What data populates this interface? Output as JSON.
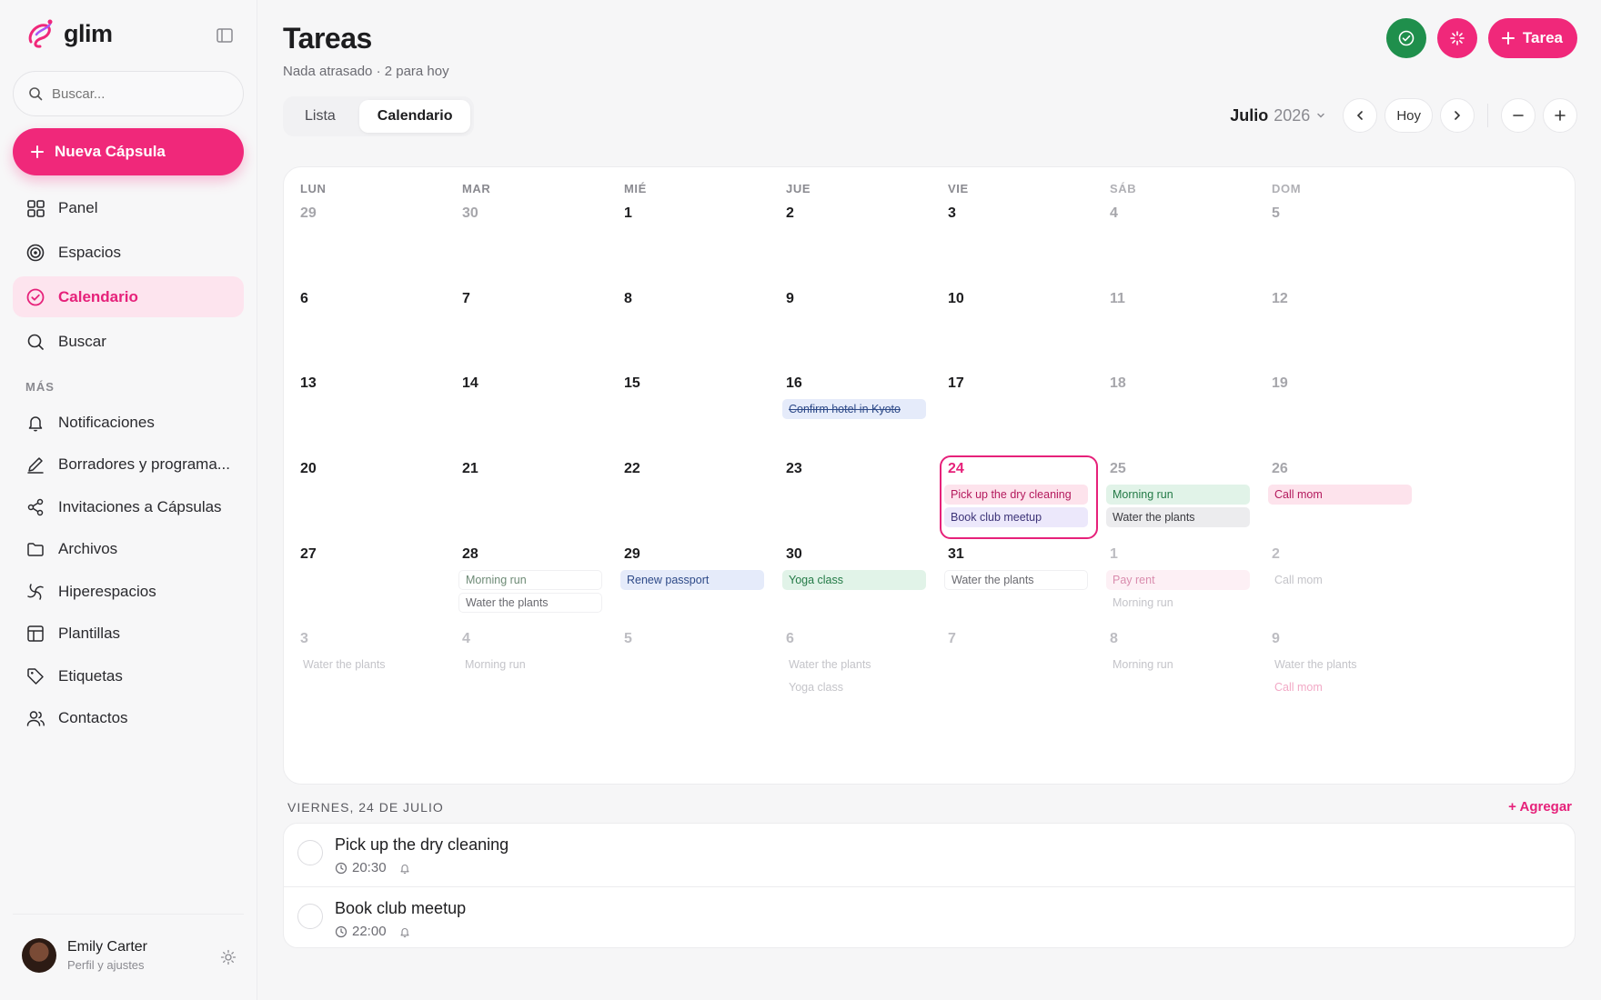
{
  "brand": {
    "name": "glim",
    "accent": "#f0287a"
  },
  "sidebar": {
    "search_placeholder": "Buscar...",
    "new_button": "Nueva Cápsula",
    "items": [
      {
        "label": "Panel",
        "icon": "grid-icon"
      },
      {
        "label": "Espacios",
        "icon": "target-icon"
      },
      {
        "label": "Calendario",
        "icon": "check-circle-icon",
        "active": true
      },
      {
        "label": "Buscar",
        "icon": "search-icon"
      }
    ],
    "more_label": "MÁS",
    "more_items": [
      {
        "label": "Notificaciones",
        "icon": "bell-icon"
      },
      {
        "label": "Borradores y programa...",
        "icon": "pen-icon"
      },
      {
        "label": "Invitaciones a Cápsulas",
        "icon": "share-icon"
      },
      {
        "label": "Archivos",
        "icon": "folder-icon"
      },
      {
        "label": "Hiperespacios",
        "icon": "swirl-icon"
      },
      {
        "label": "Plantillas",
        "icon": "template-icon"
      },
      {
        "label": "Etiquetas",
        "icon": "tag-icon"
      },
      {
        "label": "Contactos",
        "icon": "users-icon"
      }
    ],
    "profile": {
      "name": "Emily Carter",
      "subtitle": "Perfil y ajustes"
    }
  },
  "header": {
    "title": "Tareas",
    "subtitle": "Nada atrasado · 2 para hoy",
    "task_button": "Tarea",
    "tabs": [
      "Lista",
      "Calendario"
    ],
    "active_tab": 1,
    "month": "Julio",
    "year": "2026",
    "today_button": "Hoy"
  },
  "calendar": {
    "weekdays": [
      "LUN",
      "MAR",
      "MIÉ",
      "JUE",
      "VIE",
      "SÁB",
      "DOM"
    ],
    "today": {
      "week": 3,
      "day": 4
    },
    "weeks": [
      [
        {
          "n": "29",
          "s": "muted"
        },
        {
          "n": "30",
          "s": "muted"
        },
        {
          "n": "1"
        },
        {
          "n": "2"
        },
        {
          "n": "3"
        },
        {
          "n": "4",
          "s": "muted"
        },
        {
          "n": "5",
          "s": "muted"
        }
      ],
      [
        {
          "n": "6"
        },
        {
          "n": "7"
        },
        {
          "n": "8"
        },
        {
          "n": "9"
        },
        {
          "n": "10"
        },
        {
          "n": "11",
          "s": "muted"
        },
        {
          "n": "12",
          "s": "muted"
        }
      ],
      [
        {
          "n": "13"
        },
        {
          "n": "14"
        },
        {
          "n": "15"
        },
        {
          "n": "16",
          "events": [
            {
              "t": "Confirm hotel in Kyoto",
              "c": "blue strike"
            }
          ]
        },
        {
          "n": "17"
        },
        {
          "n": "18",
          "s": "muted"
        },
        {
          "n": "19",
          "s": "muted"
        }
      ],
      [
        {
          "n": "20"
        },
        {
          "n": "21"
        },
        {
          "n": "22"
        },
        {
          "n": "23"
        },
        {
          "n": "24",
          "s": "today",
          "events": [
            {
              "t": "Pick up the dry cleaning",
              "c": "pink"
            },
            {
              "t": "Book club meetup",
              "c": "purple"
            }
          ]
        },
        {
          "n": "25",
          "s": "muted",
          "events": [
            {
              "t": "Morning run",
              "c": "green"
            },
            {
              "t": "Water the plants",
              "c": "gray"
            }
          ]
        },
        {
          "n": "26",
          "s": "muted",
          "events": [
            {
              "t": "Call mom",
              "c": "pink"
            }
          ]
        }
      ],
      [
        {
          "n": "27"
        },
        {
          "n": "28",
          "events": [
            {
              "t": "Morning run",
              "c": "outline"
            },
            {
              "t": "Water the plants",
              "c": "outline gtext"
            }
          ]
        },
        {
          "n": "29",
          "events": [
            {
              "t": "Renew passport",
              "c": "blue"
            }
          ]
        },
        {
          "n": "30",
          "events": [
            {
              "t": "Yoga class",
              "c": "green"
            }
          ]
        },
        {
          "n": "31",
          "events": [
            {
              "t": "Water the plants",
              "c": "outline gtext"
            }
          ]
        },
        {
          "n": "1",
          "s": "faded",
          "events": [
            {
              "t": "Pay rent",
              "c": "pink faded"
            },
            {
              "t": "Morning run",
              "c": "ghost"
            }
          ]
        },
        {
          "n": "2",
          "s": "faded",
          "events": [
            {
              "t": "Call mom",
              "c": "ghost"
            }
          ]
        }
      ],
      [
        {
          "n": "3",
          "s": "faded",
          "events": [
            {
              "t": "Water the plants",
              "c": "ghost"
            }
          ]
        },
        {
          "n": "4",
          "s": "faded",
          "events": [
            {
              "t": "Morning run",
              "c": "ghost"
            }
          ]
        },
        {
          "n": "5",
          "s": "faded"
        },
        {
          "n": "6",
          "s": "faded",
          "events": [
            {
              "t": "Water the plants",
              "c": "ghost"
            },
            {
              "t": "Yoga class",
              "c": "ghost"
            }
          ]
        },
        {
          "n": "7",
          "s": "faded"
        },
        {
          "n": "8",
          "s": "faded",
          "events": [
            {
              "t": "Morning run",
              "c": "ghost"
            }
          ]
        },
        {
          "n": "9",
          "s": "faded",
          "events": [
            {
              "t": "Water the plants",
              "c": "ghost"
            },
            {
              "t": "Call mom",
              "c": "ghost pink"
            }
          ]
        }
      ]
    ]
  },
  "agenda": {
    "heading": "VIERNES, 24 DE JULIO",
    "add_label": "+ Agregar",
    "items": [
      {
        "title": "Pick up the dry cleaning",
        "time": "20:30"
      },
      {
        "title": "Book club meetup",
        "time": "22:00"
      }
    ]
  }
}
